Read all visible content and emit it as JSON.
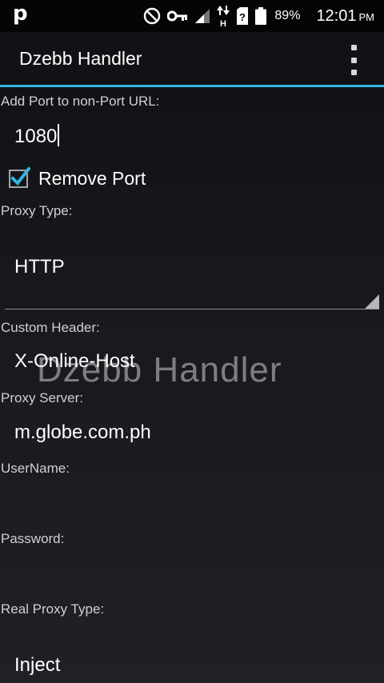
{
  "status_bar": {
    "notification_icon": "p",
    "battery_percent": "89%",
    "time": "12:01",
    "ampm": "PM",
    "icons": [
      "do-not-disturb-icon",
      "vpn-key-icon",
      "signal-icon",
      "data-arrows-icon",
      "sim-unknown-icon",
      "battery-icon"
    ]
  },
  "action_bar": {
    "title": "Dzebb Handler",
    "accent_color": "#33b5e5"
  },
  "form": {
    "port_label": "Add Port to non-Port URL:",
    "port_value": "1080",
    "remove_port_label": "Remove Port",
    "remove_port_checked": true,
    "proxy_type_label": "Proxy Type:",
    "proxy_type_value": "HTTP",
    "custom_header_label": "Custom Header:",
    "custom_header_value": "X-Online-Host",
    "proxy_server_label": "Proxy Server:",
    "proxy_server_value": "m.globe.com.ph",
    "username_label": "UserName:",
    "username_value": "",
    "password_label": "Password:",
    "password_value": "",
    "real_proxy_type_label": "Real Proxy Type:",
    "real_proxy_type_value": "Inject"
  },
  "watermark": "Dzebb Handler"
}
